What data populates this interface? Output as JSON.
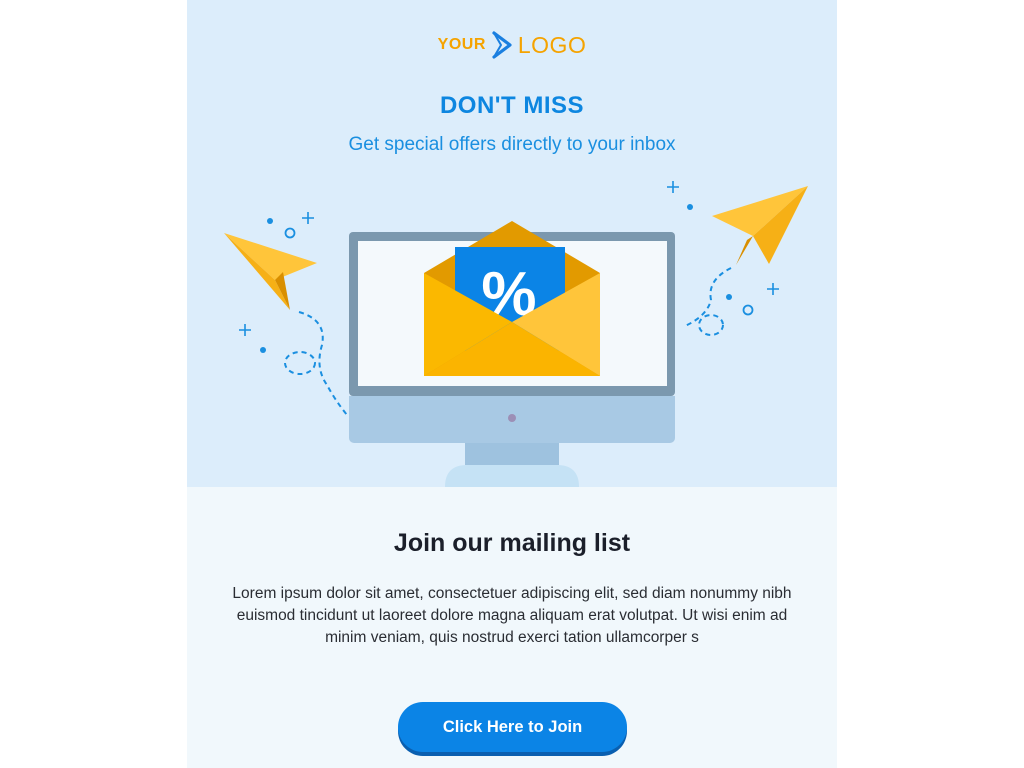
{
  "logo": {
    "your": "YOUR",
    "word": "LOGO",
    "icon": "chevron-right-icon"
  },
  "hero": {
    "headline": "DON'T MISS",
    "subheadline": "Get special offers directly to your inbox"
  },
  "illustration": {
    "coupon_symbol": "%",
    "icons": [
      "monitor-icon",
      "envelope-icon",
      "paper-plane-icon"
    ]
  },
  "content": {
    "title": "Join our mailing list",
    "body": "Lorem ipsum dolor sit amet, consectetuer adipiscing elit, sed diam nonummy nibh euismod tincidunt ut laoreet dolore magna aliquam erat volutpat. Ut wisi enim ad minim veniam, quis nostrud exerci tation ullamcorper s"
  },
  "cta": {
    "label": "Click Here to Join"
  },
  "colors": {
    "hero_background": "#dcedfb",
    "body_background": "#f1f8fc",
    "accent_blue": "#0b84e6",
    "accent_yellow": "#f5a300"
  }
}
